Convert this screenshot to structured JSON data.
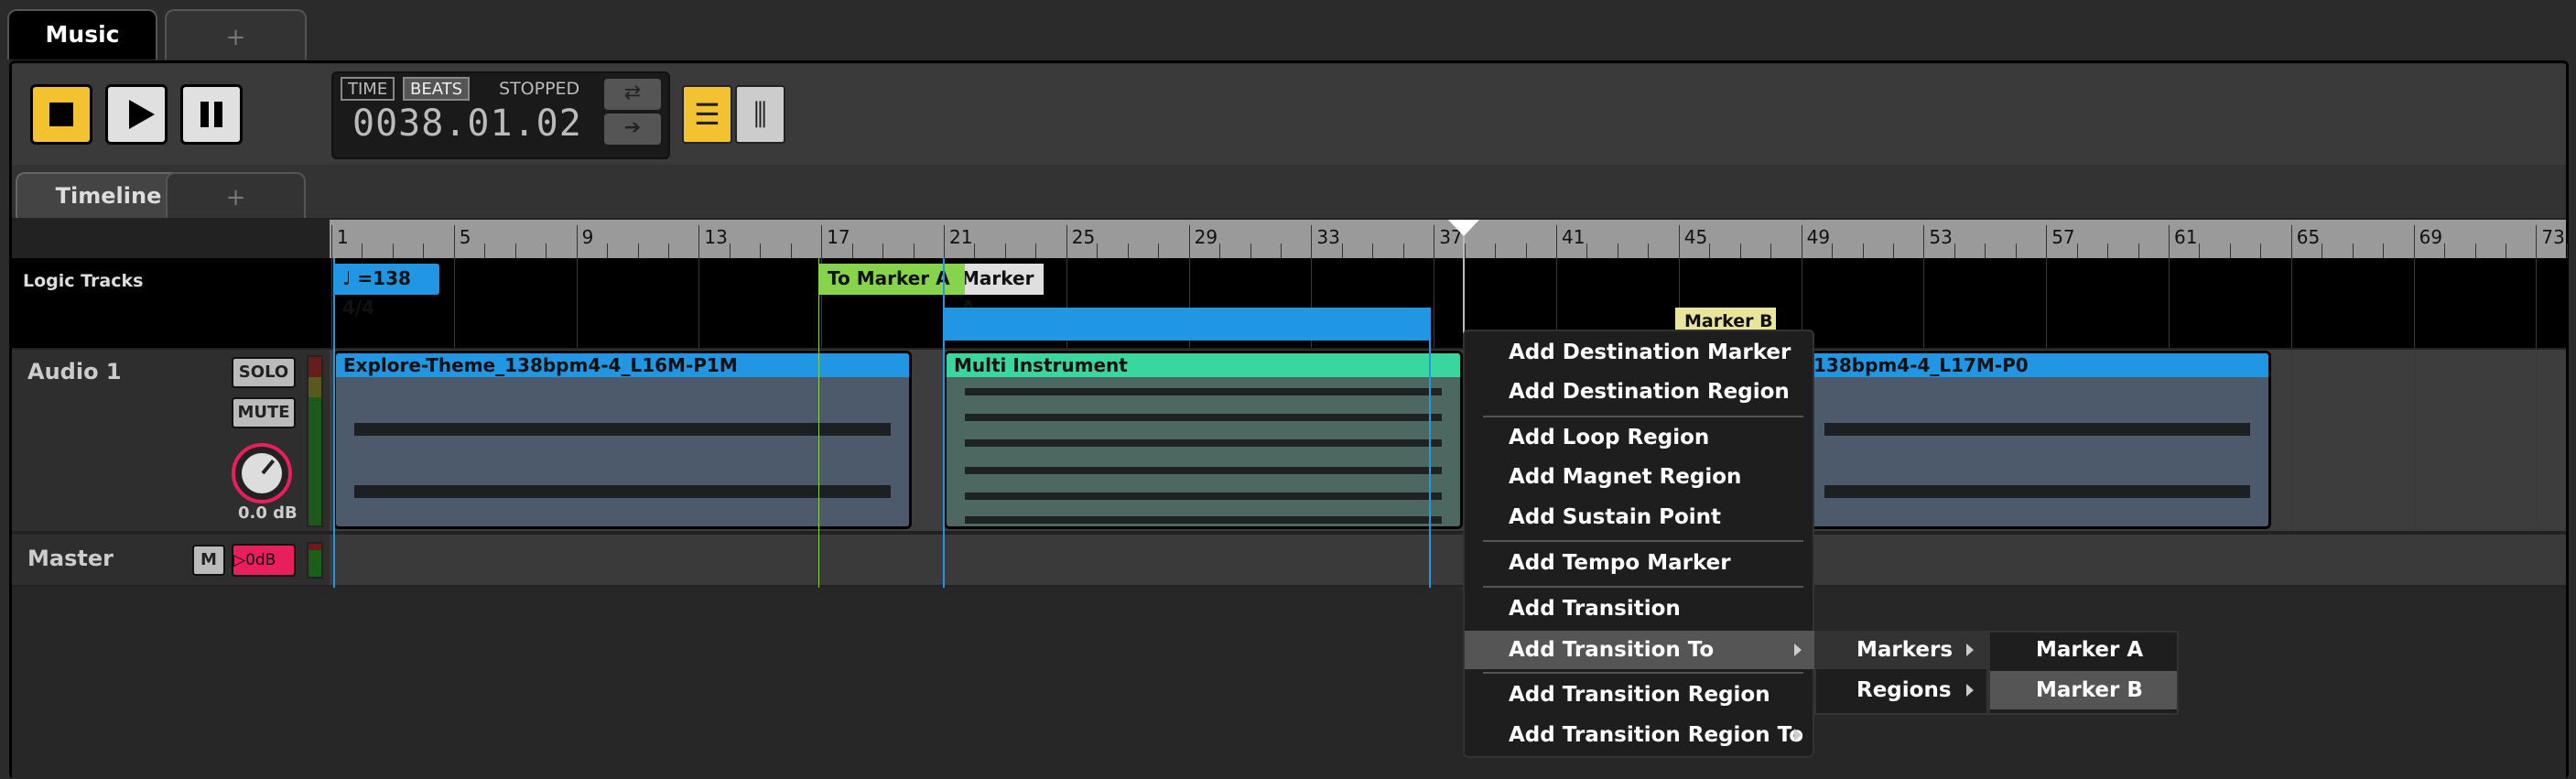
{
  "tabs": {
    "top": [
      {
        "label": "Music"
      },
      {
        "label": "+"
      }
    ],
    "timeline": [
      {
        "label": "Timeline"
      },
      {
        "label": "+"
      }
    ]
  },
  "transport": {
    "clock_time": "TIME",
    "clock_beats": "BEATS",
    "status": "STOPPED",
    "position": "0038.01.02",
    "loop_icon": "loop-icon",
    "follow_icon": "arrow-right-icon"
  },
  "ruler": {
    "bars": [
      "1",
      "5",
      "9",
      "13",
      "17",
      "21",
      "25",
      "29",
      "33",
      "37",
      "41",
      "45",
      "49",
      "53",
      "57",
      "61",
      "65",
      "69",
      "73"
    ]
  },
  "logic_tracks": {
    "label": "Logic Tracks",
    "tempo": "=138 4/4",
    "tempo_icon": "note-icon",
    "to_marker_a": "To Marker A",
    "marker_a": "Marker A",
    "marker_b": "Marker B"
  },
  "tracks": {
    "audio1": {
      "name": "Audio 1",
      "solo": "SOLO",
      "mute": "MUTE",
      "gain": "0.0 dB"
    },
    "master": {
      "name": "Master",
      "mute": "M",
      "volume": "▷0dB"
    }
  },
  "clips": [
    {
      "name": "Explore-Theme_138bpm4-4_L16M-P1M"
    },
    {
      "name": "Multi Instrument"
    },
    {
      "name": "138bpm4-4_L17M-P0"
    }
  ],
  "context_menu": {
    "items": [
      "Add Destination Marker",
      "Add Destination Region",
      "Add Loop Region",
      "Add Magnet Region",
      "Add Sustain Point",
      "Add Tempo Marker",
      "Add Transition",
      "Add Transition To",
      "Add Transition Region",
      "Add Transition Region To"
    ],
    "submenu": [
      "Markers",
      "Regions"
    ],
    "submenu2": [
      "Marker A",
      "Marker B"
    ]
  },
  "colors": {
    "accent": "#f2c230",
    "blue": "#2196e3",
    "green": "#88d34c",
    "teal": "#3ad6a0",
    "pink": "#e81f5a"
  }
}
